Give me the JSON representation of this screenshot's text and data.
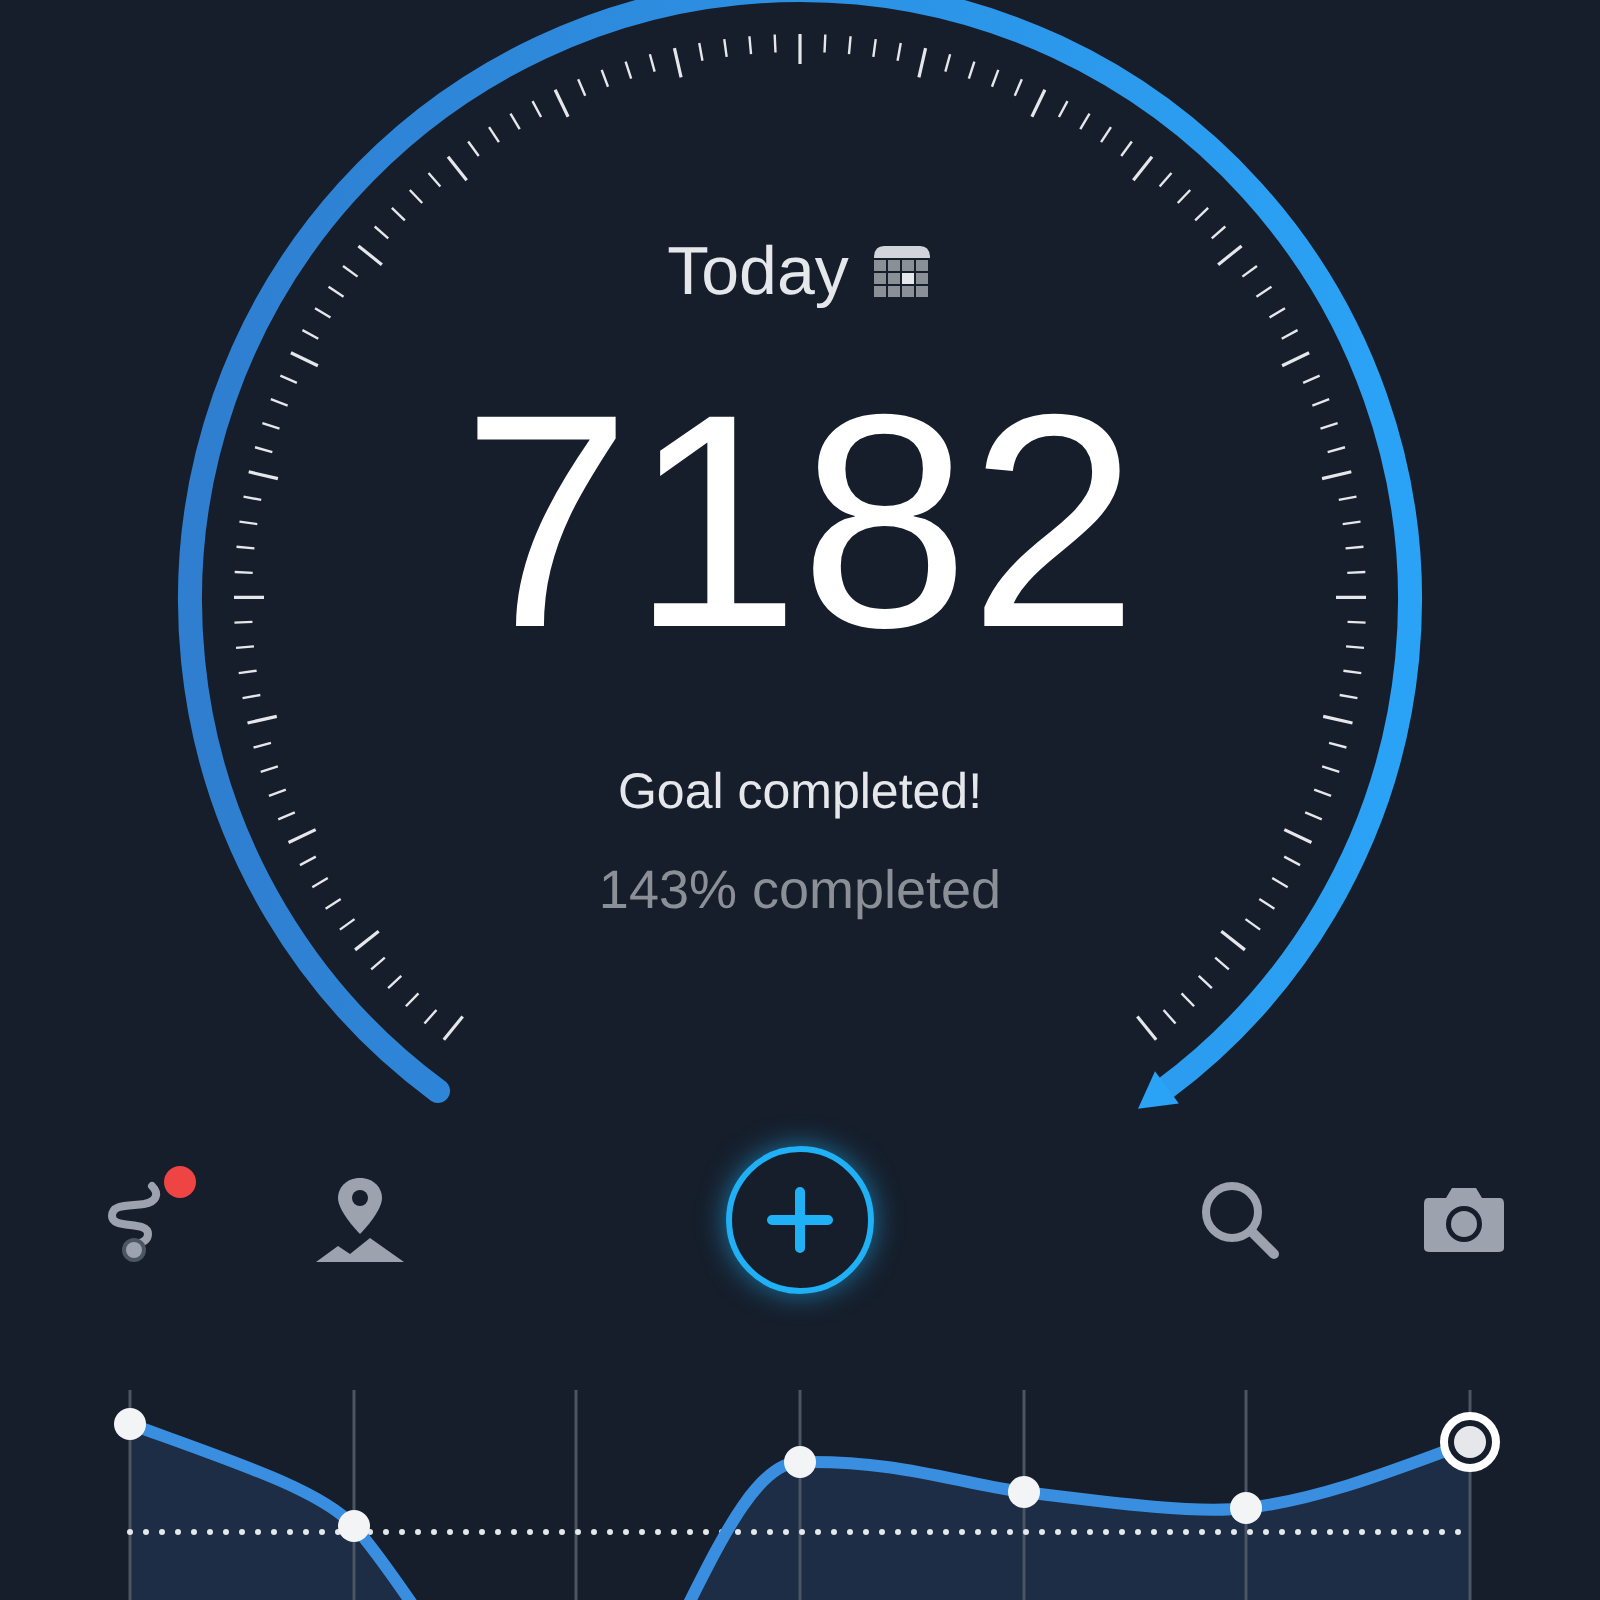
{
  "header": {
    "label": "Today"
  },
  "steps": "7182",
  "status": "Goal completed!",
  "percent": "143% completed",
  "toolbar": [
    {
      "kind": "route",
      "badge": true
    },
    {
      "kind": "map"
    },
    {
      "kind": "add"
    },
    {
      "kind": "search"
    },
    {
      "kind": "camera"
    }
  ]
}
